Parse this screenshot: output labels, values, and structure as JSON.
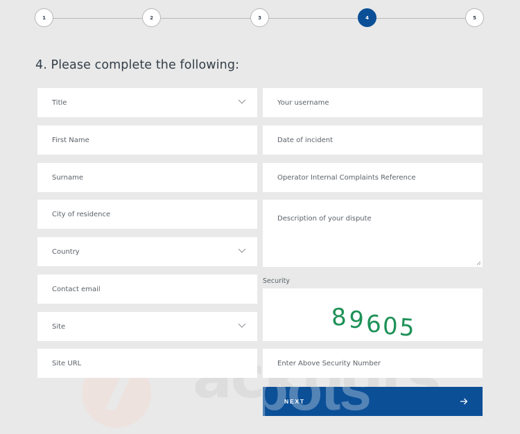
{
  "stepper": {
    "steps": [
      "1",
      "2",
      "3",
      "4",
      "5"
    ],
    "active_step": 4
  },
  "heading": "4. Please complete the following:",
  "form": {
    "title": {
      "placeholder": "Title",
      "type": "select"
    },
    "first_name": {
      "placeholder": "First Name"
    },
    "surname": {
      "placeholder": "Surname"
    },
    "city": {
      "placeholder": "City of residence"
    },
    "country": {
      "placeholder": "Country",
      "type": "select"
    },
    "email": {
      "placeholder": "Contact email"
    },
    "site": {
      "placeholder": "Site",
      "type": "select"
    },
    "site_url": {
      "placeholder": "Site URL"
    },
    "username": {
      "placeholder": "Your username"
    },
    "date": {
      "placeholder": "Date of incident"
    },
    "reference": {
      "placeholder": "Operator Internal Complaints Reference"
    },
    "description": {
      "placeholder": "Description of your dispute"
    },
    "security_label": "Security",
    "captcha_digits": [
      "8",
      "9",
      "6",
      "0",
      "5"
    ],
    "security_input": {
      "placeholder": "Enter Above Security Number"
    }
  },
  "next_button": {
    "label": "NEXT",
    "icon": "arrow-right-icon"
  },
  "watermark": {
    "text": "ackpots",
    "logo_glyph": "7"
  },
  "colors": {
    "accent": "#0b4f97",
    "captcha": "#1e9157",
    "background": "#e8e9e8"
  }
}
